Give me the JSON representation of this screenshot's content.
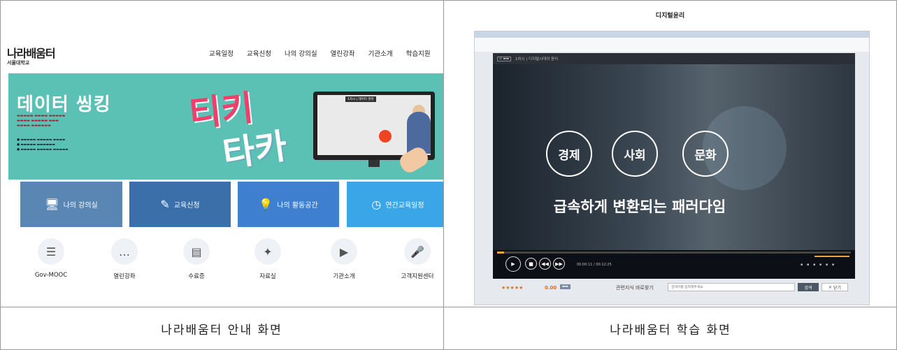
{
  "captions": {
    "left": "나라배움터 안내 화면",
    "right": "나라배움터 학습 화면"
  },
  "guide": {
    "logo": "나라배움터",
    "logo_sub": "서울대학교",
    "nav": [
      "교육일정",
      "교육신청",
      "나의 강의실",
      "열린강좌",
      "기관소개",
      "학습지원"
    ],
    "banner": {
      "title": "데이터 씽킹",
      "big_text_1": "티키",
      "big_text_2": "타카",
      "monitor_header": "1차시 | 데이터 씽킹"
    },
    "tiles": [
      {
        "label": "나의 강의실",
        "icon": "monitor-icon"
      },
      {
        "label": "교육신청",
        "icon": "pen-icon"
      },
      {
        "label": "나의 활동공간",
        "icon": "lightbulb-icon"
      },
      {
        "label": "연간교육일정",
        "icon": "clock-icon"
      }
    ],
    "quick_links": [
      {
        "label": "Gov-MOOC",
        "icon": "books-icon"
      },
      {
        "label": "열린강좌",
        "icon": "chat-icon"
      },
      {
        "label": "수료증",
        "icon": "certificate-icon"
      },
      {
        "label": "자료실",
        "icon": "lightbulb-icon"
      },
      {
        "label": "기관소개",
        "icon": "video-icon"
      },
      {
        "label": "고객지원센터",
        "icon": "microphone-icon"
      }
    ]
  },
  "learning": {
    "page_title": "디지털윤리",
    "lesson": "1차시 | 디지털시대의 윤리",
    "video": {
      "circles": [
        "경제",
        "사회",
        "문화"
      ],
      "headline": "급속하게 변환되는 패러다임",
      "progress": 0.02,
      "time": "00:00:11 / 00:12:25"
    },
    "rating_value": "0.00",
    "search_label": "관련지식 바로찾기",
    "search_placeholder": "검색어를 입력해주세요",
    "search_button": "검색",
    "close_button": "닫기"
  },
  "colors": {
    "banner_bg": "#5cc1b5",
    "tile_1": "#5a86b3",
    "tile_2": "#3a6fa9",
    "tile_3": "#3e7fd0",
    "tile_4": "#3aa6e8",
    "accent_orange": "#e9a83b"
  }
}
